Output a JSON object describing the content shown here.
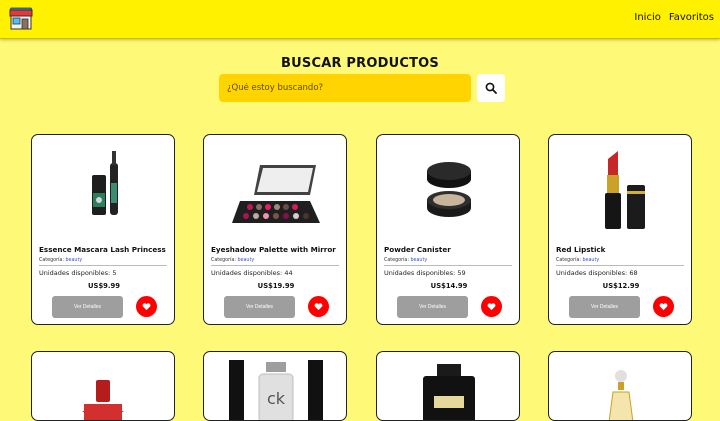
{
  "nav": {
    "links": [
      "Inicio",
      "Favoritos"
    ]
  },
  "search": {
    "title": "BUSCAR PRODUCTOS",
    "placeholder": "¿Qué estoy buscando?"
  },
  "card_labels": {
    "category_prefix": "Categoría:",
    "units_prefix": "Unidades disponibles:",
    "details_button": "Ver Detalles"
  },
  "products": [
    {
      "name": "Essence Mascara Lash Princess",
      "category": "beauty",
      "units": "5",
      "price": "US$9.99",
      "icon": "mascara-icon"
    },
    {
      "name": "Eyeshadow Palette with Mirror",
      "category": "beauty",
      "units": "44",
      "price": "US$19.99",
      "icon": "eyeshadow-palette-icon"
    },
    {
      "name": "Powder Canister",
      "category": "beauty",
      "units": "59",
      "price": "US$14.99",
      "icon": "powder-canister-icon"
    },
    {
      "name": "Red Lipstick",
      "category": "beauty",
      "units": "68",
      "price": "US$12.99",
      "icon": "lipstick-icon"
    }
  ],
  "colors": {
    "page_bg": "#fff978",
    "navbar_bg": "#fff100",
    "search_bg": "#ffd400",
    "fav_red": "#ff0000",
    "details_gray": "#9e9e9e"
  }
}
